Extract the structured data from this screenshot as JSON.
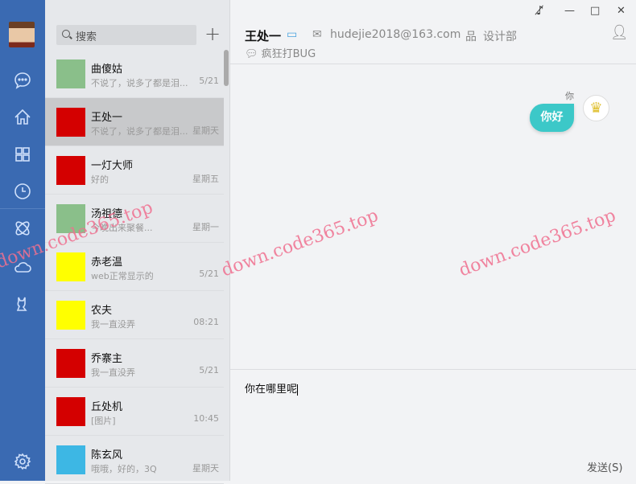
{
  "nav": {
    "items": [
      "chat-icon",
      "home-icon",
      "apps-icon",
      "clock-icon",
      "atom-icon",
      "cloud-icon",
      "cat-icon",
      "gear-icon"
    ]
  },
  "search": {
    "placeholder": "搜索",
    "add": "+"
  },
  "conversations": [
    {
      "name": "曲傻姑",
      "preview": "不说了，说多了都是泪...",
      "time": "5/21",
      "color": "#8abf8a"
    },
    {
      "name": "王处一",
      "preview": "不说了，说多了都是泪...",
      "time": "星期天",
      "color": "#d40000",
      "selected": true
    },
    {
      "name": "一灯大师",
      "preview": "好的",
      "time": "星期五",
      "color": "#d40000"
    },
    {
      "name": "汤祖德",
      "preview": "今晚出来聚餐...",
      "time": "星期一",
      "color": "#8abf8a"
    },
    {
      "name": "赤老温",
      "preview": "web正常显示的",
      "time": "5/21",
      "color": "#ffff00"
    },
    {
      "name": "农夫",
      "preview": "我一直没弄",
      "time": "08:21",
      "color": "#ffff00"
    },
    {
      "name": "乔寨主",
      "preview": "我一直没弄",
      "time": "5/21",
      "color": "#d40000"
    },
    {
      "name": "丘处机",
      "preview": "[图片]",
      "time": "10:45",
      "color": "#d40000"
    },
    {
      "name": "陈玄风",
      "preview": "哦哦，好的，3Q",
      "time": "星期天",
      "color": "#3db7e4"
    }
  ],
  "chat": {
    "name": "王处一",
    "email": "hudejie2018@163.com",
    "dept": "设计部",
    "signature": "疯狂打BUG",
    "messages": [
      {
        "sender": "你",
        "text": "你好"
      }
    ],
    "input": "你在哪里呢",
    "send": "发送(S)"
  },
  "window": {
    "minimize": "—",
    "maximize": "□",
    "close": "✕"
  },
  "watermark": "down.code365.top"
}
